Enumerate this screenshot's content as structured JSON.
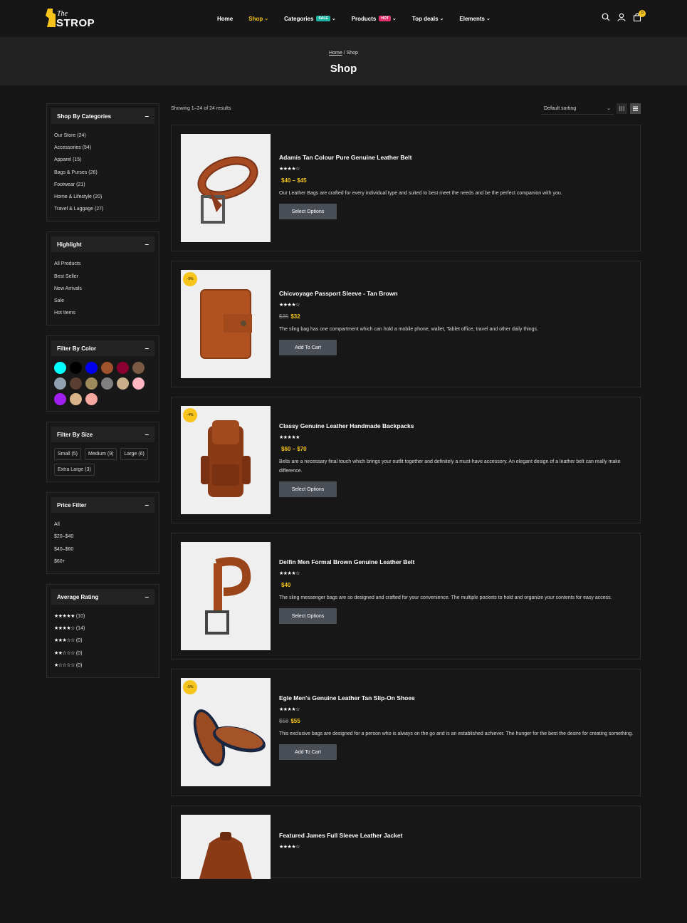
{
  "header": {
    "logo_the": "The",
    "logo_strop": "STROP",
    "nav": [
      {
        "label": "Home"
      },
      {
        "label": "Shop",
        "chevron": "⌄"
      },
      {
        "label": "Categories",
        "badge": "SALE",
        "chevron": "⌄"
      },
      {
        "label": "Products",
        "badge": "HOT",
        "chevron": "⌄"
      },
      {
        "label": "Top deals",
        "chevron": "⌄"
      },
      {
        "label": "Elements",
        "chevron": "⌄"
      }
    ],
    "cart_count": "0",
    "accent_color": "#f6c41a"
  },
  "banner": {
    "crumb_home": "Home",
    "crumb_sep": " / ",
    "crumb_current": "Shop",
    "title": "Shop"
  },
  "sidebar": {
    "categories": {
      "title": "Shop By Categories",
      "toggle": "–",
      "items": [
        "Our Store (24)",
        "Accessories (54)",
        "Apparel (15)",
        "Bags & Purses (26)",
        "Footwear (21)",
        "Home & Lifestyle (20)",
        "Travel & Luggage (27)"
      ]
    },
    "highlight": {
      "title": "Highlight",
      "toggle": "–",
      "items": [
        "All Products",
        "Best Seller",
        "New Arrivals",
        "Sale",
        "Hot Items"
      ]
    },
    "color": {
      "title": "Filter By Color",
      "toggle": "–",
      "swatches": [
        "#00ffff",
        "#000000",
        "#0000ee",
        "#a0522d",
        "#8b0030",
        "#7a5a44",
        "#8fa0b0",
        "#5a3e30",
        "#9e8a5a",
        "#808080",
        "#c9b08a",
        "#ffb6c1",
        "#a020f0",
        "#d9b48a",
        "#f6a9a0"
      ]
    },
    "size": {
      "title": "Filter By Size",
      "toggle": "–",
      "items": [
        "Small (5)",
        "Medium (9)",
        "Large (6)",
        "Extra Large (3)"
      ]
    },
    "price": {
      "title": "Price Filter",
      "toggle": "–",
      "items": [
        "All",
        "$20–$40",
        "$40–$60",
        "$60+"
      ]
    },
    "rating": {
      "title": "Average Rating",
      "toggle": "–",
      "items": [
        {
          "stars": "★★★★★",
          "count": "(10)"
        },
        {
          "stars": "★★★★☆",
          "count": "(14)"
        },
        {
          "stars": "★★★☆☆",
          "count": "(0)"
        },
        {
          "stars": "★★☆☆☆",
          "count": "(0)"
        },
        {
          "stars": "★☆☆☆☆",
          "count": "(0)"
        }
      ]
    }
  },
  "shop": {
    "showing": "Showing 1–24 of 24 results",
    "sort": "Default sorting",
    "sort_chevron": "⌄",
    "products": [
      {
        "name": "Adamis Tan Colour Pure Genuine Leather Belt",
        "stars": "★★★★☆",
        "old_price": "",
        "price": "$40 – $45",
        "discount": "",
        "desc": "Our Leather Bags are crafted for every individual type and suited to best meet the needs and be the perfect companion with you.",
        "button": "Select Options",
        "icon": "belt-coiled"
      },
      {
        "name": "Chicvoyage Passport Sleeve - Tan Brown",
        "stars": "★★★★☆",
        "old_price": "$35",
        "price": "$32",
        "discount": "-9%",
        "desc": "The sling bag has one compartment which can hold a mobile phone, wallet, Tablet office, travel and other daily things.",
        "button": "Add To Cart",
        "icon": "wallet"
      },
      {
        "name": "Classy Genuine Leather Handmade Backpacks",
        "stars": "★★★★★",
        "old_price": "",
        "price": "$60 – $70",
        "discount": "-4%",
        "desc": "Belts are a necessary final touch which brings your outfit together and definitely a must-have accessory. An elegant design of a leather belt can really make difference.",
        "button": "Select Options",
        "icon": "backpack"
      },
      {
        "name": "Delfin Men Formal Brown Genuine Leather Belt",
        "stars": "★★★★☆",
        "old_price": "",
        "price": "$40",
        "discount": "",
        "desc": "The sling messenger bags are so designed and crafted for your convenience. The multiple pockets to hold and organize your contents for easy access.",
        "button": "Select Options",
        "icon": "belt-rolled"
      },
      {
        "name": "Egle Men's Genuine Leather Tan Slip-On Shoes",
        "stars": "★★★★☆",
        "old_price": "$58",
        "price": "$55",
        "discount": "-5%",
        "desc": "This exclusive bags are designed for a person who is always on the go and is an established achiever. The hunger for the best the desire for creating something.",
        "button": "Add To Cart",
        "icon": "shoes"
      },
      {
        "name": "Featured James Full Sleeve Leather Jacket",
        "stars": "★★★★☆",
        "old_price": "",
        "price": "",
        "discount": "",
        "desc": "",
        "button": "",
        "icon": "jacket"
      }
    ]
  }
}
